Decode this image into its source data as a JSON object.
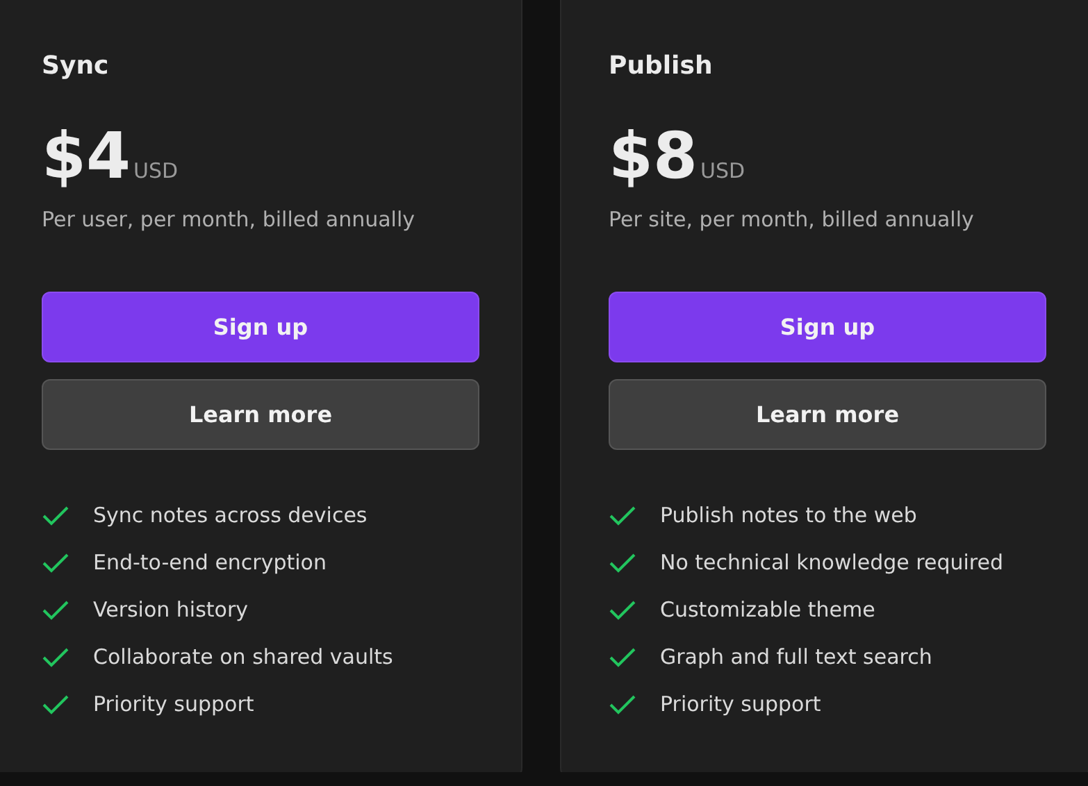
{
  "plans": [
    {
      "name": "Sync",
      "price": "$4",
      "currency": "USD",
      "billing": "Per user, per month, billed annually",
      "primary_button": "Sign up",
      "secondary_button": "Learn more",
      "features": [
        "Sync notes across devices",
        "End-to-end encryption",
        "Version history",
        "Collaborate on shared vaults",
        "Priority support"
      ]
    },
    {
      "name": "Publish",
      "price": "$8",
      "currency": "USD",
      "billing": "Per site, per month, billed annually",
      "primary_button": "Sign up",
      "secondary_button": "Learn more",
      "features": [
        "Publish notes to the web",
        "No technical knowledge required",
        "Customizable theme",
        "Graph and full text search",
        "Priority support"
      ]
    }
  ]
}
